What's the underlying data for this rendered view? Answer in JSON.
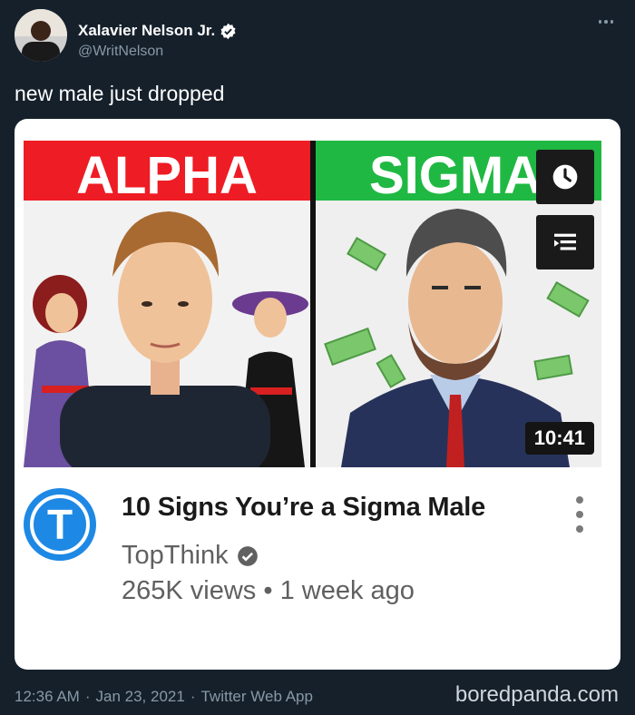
{
  "tweet": {
    "author_name": "Xalavier Nelson Jr.",
    "handle": "@WritNelson",
    "text": "new male just dropped",
    "time": "12:36 AM",
    "separator1": "·",
    "date": "Jan 23, 2021",
    "separator2": "·",
    "source": "Twitter Web App"
  },
  "video": {
    "thumbnail_left_label": "ALPHA",
    "thumbnail_right_label": "SIGMA",
    "duration": "10:41",
    "title": "10 Signs You’re a Sigma Male",
    "channel_logo_letter": "T",
    "channel": "TopThink",
    "views": "265K views",
    "meta_separator": "•",
    "uploaded": "1 week ago"
  },
  "watermark": "boredpanda.com",
  "icons": {
    "verified": "verified-badge-icon",
    "more": "more-horizontal-icon",
    "watch_later": "clock-icon",
    "add_to_queue": "queue-icon",
    "video_menu": "more-vertical-icon"
  },
  "colors": {
    "background": "#15202b",
    "alpha_banner": "#ee1c24",
    "sigma_banner": "#1fb842",
    "channel_blue": "#1e88e5"
  }
}
